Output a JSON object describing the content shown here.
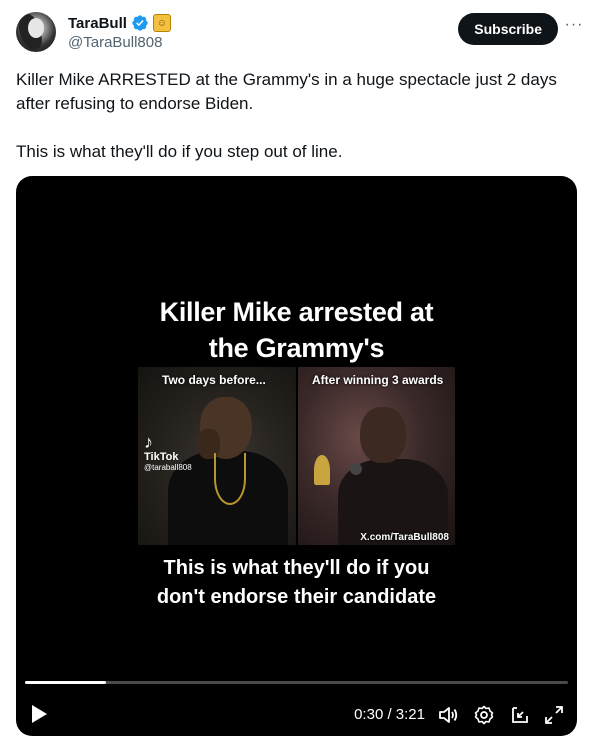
{
  "author": {
    "display_name": "TaraBull",
    "handle": "@TaraBull808",
    "verified": true,
    "badge_icon": "gold-affiliate-badge-icon"
  },
  "actions": {
    "subscribe_label": "Subscribe",
    "more_icon": "more-options-icon"
  },
  "tweet": {
    "text": "Killer Mike ARRESTED at the Grammy's in a huge spectacle just 2 days after refusing to endorse Biden.\n\nThis is what they'll do if you step out of line."
  },
  "video": {
    "title_line1": "Killer Mike arrested at",
    "title_line2": "the Grammy's",
    "left_label": "Two days before...",
    "right_label": "After winning 3 awards",
    "tiktok_name": "TikTok",
    "tiktok_user": "@taraball808",
    "watermark": "X.com/TaraBull808",
    "caption_line1": "This is what they'll do if you",
    "caption_line2": "don't endorse their candidate",
    "progress_fraction": 0.15,
    "time_display": "0:30 / 3:21",
    "icons": [
      "play-icon",
      "volume-icon",
      "settings-icon",
      "pip-icon",
      "fullscreen-icon"
    ]
  },
  "colors": {
    "text": "#0f1419",
    "secondary": "#536471",
    "verified_blue": "#1d9bf0",
    "video_bg": "#000000"
  }
}
